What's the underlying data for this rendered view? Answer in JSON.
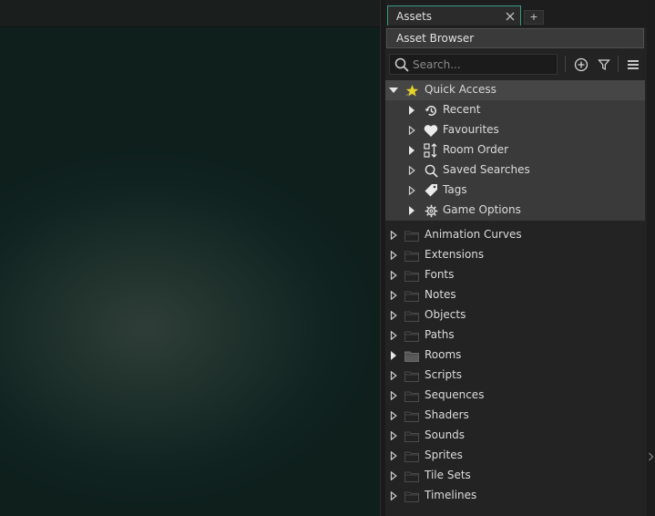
{
  "panel": {
    "tab_label": "Assets",
    "tab_add_label": "+",
    "browser_title": "Asset Browser"
  },
  "search": {
    "placeholder": "Search..."
  },
  "quick_access": {
    "label": "Quick Access",
    "items": [
      {
        "label": "Recent",
        "icon": "history-icon",
        "expanded_arrow": "filled"
      },
      {
        "label": "Favourites",
        "icon": "heart-icon",
        "expanded_arrow": "outline"
      },
      {
        "label": "Room Order",
        "icon": "room-order-icon",
        "expanded_arrow": "filled"
      },
      {
        "label": "Saved Searches",
        "icon": "search-icon",
        "expanded_arrow": "outline"
      },
      {
        "label": "Tags",
        "icon": "tag-icon",
        "expanded_arrow": "outline"
      },
      {
        "label": "Game Options",
        "icon": "gear-icon",
        "expanded_arrow": "filled"
      }
    ]
  },
  "tree": {
    "folders": [
      {
        "label": "Animation Curves"
      },
      {
        "label": "Extensions"
      },
      {
        "label": "Fonts"
      },
      {
        "label": "Notes"
      },
      {
        "label": "Objects"
      },
      {
        "label": "Paths"
      },
      {
        "label": "Rooms"
      },
      {
        "label": "Scripts"
      },
      {
        "label": "Sequences"
      },
      {
        "label": "Shaders"
      },
      {
        "label": "Sounds"
      },
      {
        "label": "Sprites"
      },
      {
        "label": "Tile Sets"
      },
      {
        "label": "Timelines"
      }
    ]
  },
  "colors": {
    "tab_accent": "#3a9a84",
    "star": "#e8d22a"
  }
}
